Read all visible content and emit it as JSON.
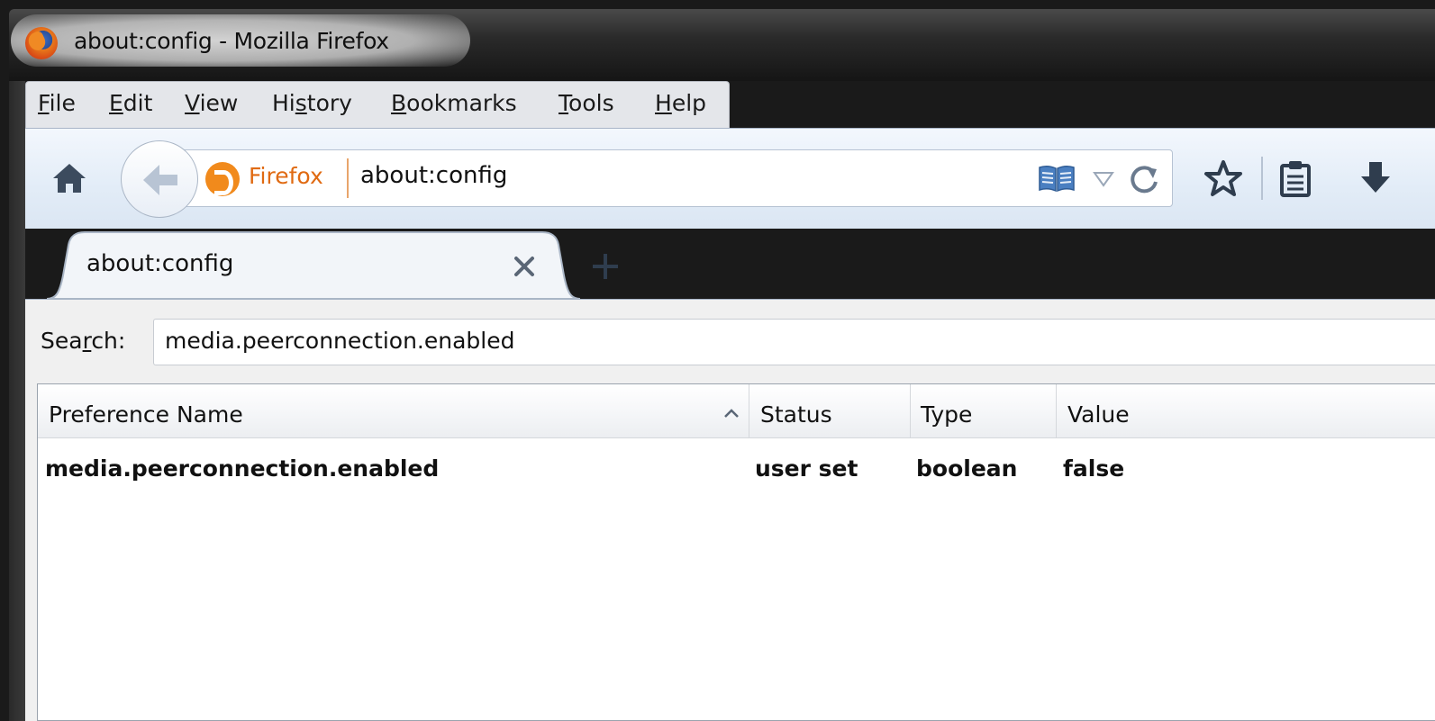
{
  "window": {
    "title": "about:config - Mozilla Firefox"
  },
  "menubar": {
    "items": [
      {
        "label": "File",
        "mnemonic": "F"
      },
      {
        "label": "Edit",
        "mnemonic": "E"
      },
      {
        "label": "View",
        "mnemonic": "V"
      },
      {
        "label": "History",
        "mnemonic": "s"
      },
      {
        "label": "Bookmarks",
        "mnemonic": "B"
      },
      {
        "label": "Tools",
        "mnemonic": "T"
      },
      {
        "label": "Help",
        "mnemonic": "H"
      }
    ]
  },
  "navbar": {
    "identity_label": "Firefox",
    "url": "about:config",
    "icons": [
      "home-icon",
      "back-arrow-icon",
      "reader-view-icon",
      "dropmarker-icon",
      "reload-icon",
      "bookmark-star-icon",
      "bookmarks-menu-icon",
      "downloads-icon"
    ]
  },
  "tabs": [
    {
      "label": "about:config",
      "selected": true
    }
  ],
  "content": {
    "search_label": "Search:",
    "search_label_mnemonic": "r",
    "search_value": "media.peerconnection.enabled",
    "columns": [
      "Preference Name",
      "Status",
      "Type",
      "Value"
    ],
    "sorted_column": "Preference Name",
    "rows": [
      {
        "name": "media.peerconnection.enabled",
        "status": "user set",
        "type": "boolean",
        "value": "false"
      }
    ]
  },
  "colors": {
    "accent": "#e06a12",
    "navbar_top": "#f3f7fd",
    "navbar_bottom": "#dbe6f3"
  }
}
